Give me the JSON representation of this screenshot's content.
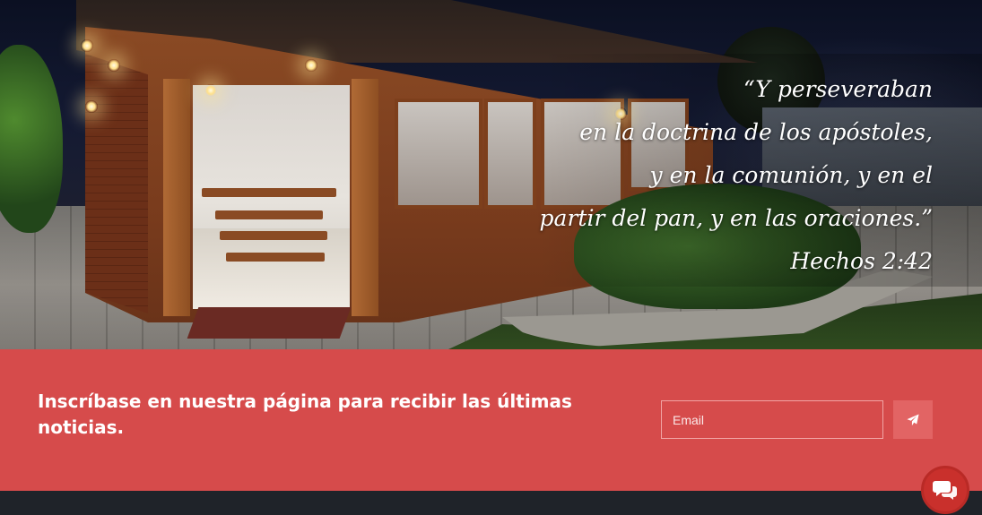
{
  "hero": {
    "verse_lines": [
      "“Y perseveraban",
      "en la doctrina de los apóstoles,",
      "y en la comunión, y en el",
      "partir del pan, y en las oraciones.”"
    ],
    "reference": "Hechos 2:42"
  },
  "signup": {
    "text": "Inscríbase en nuestra página para recibir las últimas noticias.",
    "email_placeholder": "Email",
    "submit_icon": "paper-plane-icon"
  },
  "chat": {
    "icon": "chat-bubbles-icon"
  },
  "colors": {
    "signup_bg": "#d64b4b",
    "button_bg": "#e26464",
    "footer_bg": "#1f2329",
    "chat_bg": "#c9302c"
  }
}
